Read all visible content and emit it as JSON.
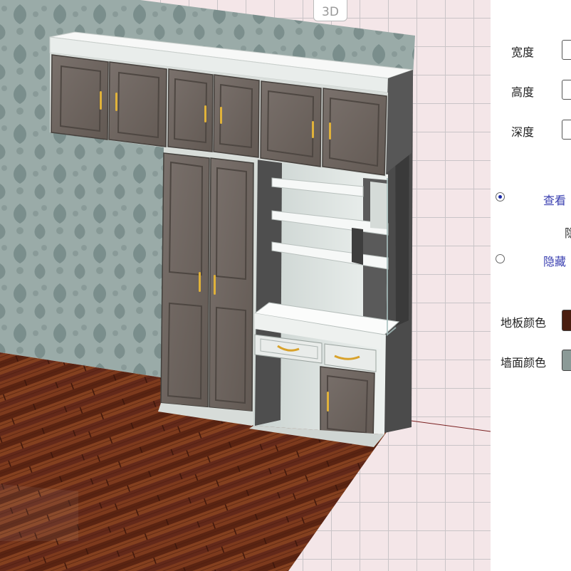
{
  "toolbar": {
    "view_3d_label": "3D"
  },
  "panel": {
    "width_label": "宽度",
    "height_label": "高度",
    "depth_label": "深度",
    "view_label": "查看",
    "hide_sub_label": "隐",
    "hide_label": "隐藏",
    "floor_color_label": "地板颜色",
    "wall_color_label": "墙面颜色"
  },
  "colors": {
    "floor_swatch": "#4a1e10",
    "wall_swatch": "#8b9a97",
    "radio_selected": "#1b2aa6",
    "radio_label": "#3a3fb0"
  },
  "icons": {
    "radio_on": "radio-selected-icon",
    "radio_off": "radio-unselected-icon"
  }
}
